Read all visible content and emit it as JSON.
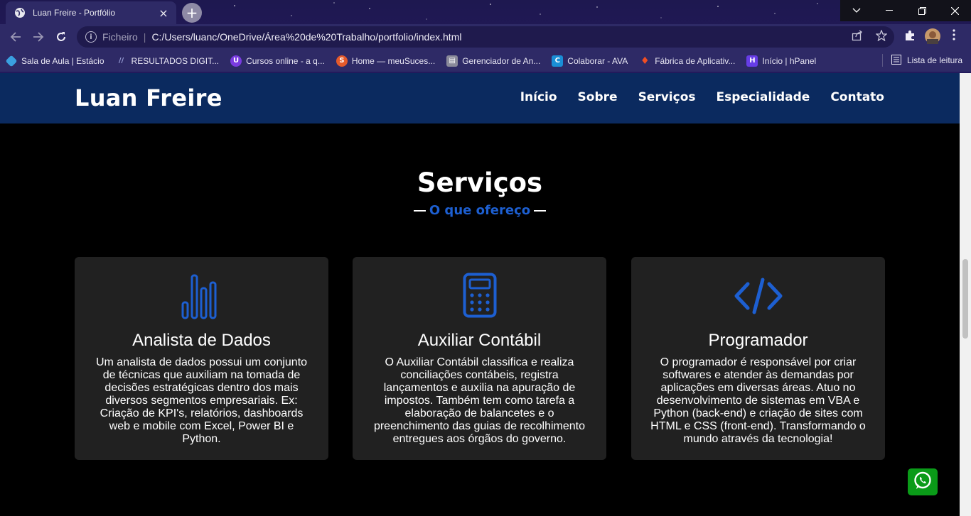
{
  "browser": {
    "tab_title": "Luan Freire - Portfólio",
    "new_tab_symbol": "+",
    "close_symbol": "×",
    "address": {
      "scheme_label": "Ficheiro",
      "url": "C:/Users/luanc/OneDrive/Área%20de%20Trabalho/portfolio/index.html"
    },
    "bookmarks": [
      {
        "label": "Sala de Aula | Estácio",
        "icon": "diamond-icon",
        "color": "#3aa0e0"
      },
      {
        "label": "RESULTADOS DIGIT...",
        "icon": "slashes-icon",
        "color": "#9aa0d8"
      },
      {
        "label": "Cursos online - a q...",
        "icon": "u-icon",
        "color": "#7a3ce0"
      },
      {
        "label": "Home — meuSuces...",
        "icon": "s-icon",
        "color": "#e55a2b"
      },
      {
        "label": "Gerenciador de An...",
        "icon": "doc-icon",
        "color": "#8a8a9a"
      },
      {
        "label": "Colaborar - AVA",
        "icon": "c-icon",
        "color": "#1a8fd6"
      },
      {
        "label": "Fábrica de Aplicativ...",
        "icon": "flame-icon",
        "color": "#f04e23"
      },
      {
        "label": "Início | hPanel",
        "icon": "h-icon",
        "color": "#673de6"
      }
    ],
    "reading_list_label": "Lista de leitura"
  },
  "site": {
    "brand": "Luan Freire",
    "nav": [
      "Início",
      "Sobre",
      "Serviços",
      "Especialidade",
      "Contato"
    ],
    "section_title": "Serviços",
    "section_subtitle": "O que ofereço",
    "accent_color": "#1d5fd1",
    "header_color": "#0b2a5f",
    "cards": [
      {
        "icon": "bar-chart-icon",
        "title": "Analista de Dados",
        "text": "Um analista de dados possui um conjunto de técnicas que auxiliam na tomada de decisões estratégicas dentro dos mais diversos segmentos empresariais. Ex: Criação de KPI's, relatórios, dashboards web e mobile com Excel, Power BI e Python."
      },
      {
        "icon": "calculator-icon",
        "title": "Auxiliar Contábil",
        "text": "O Auxiliar Contábil classifica e realiza conciliações contábeis, registra lançamentos e auxilia na apuração de impostos. Também tem como tarefa a elaboração de balancetes e o preenchimento das guias de recolhimento entregues aos órgãos do governo."
      },
      {
        "icon": "code-icon",
        "title": "Programador",
        "text": "O programador é responsável por criar softwares e atender às demandas por aplicações em diversas áreas. Atuo no desenvolvimento de sistemas em VBA e Python (back-end) e criação de sites com HTML e CSS (front-end). Transformando o mundo através da tecnologia!"
      }
    ],
    "whatsapp_color": "#0a9b18"
  }
}
